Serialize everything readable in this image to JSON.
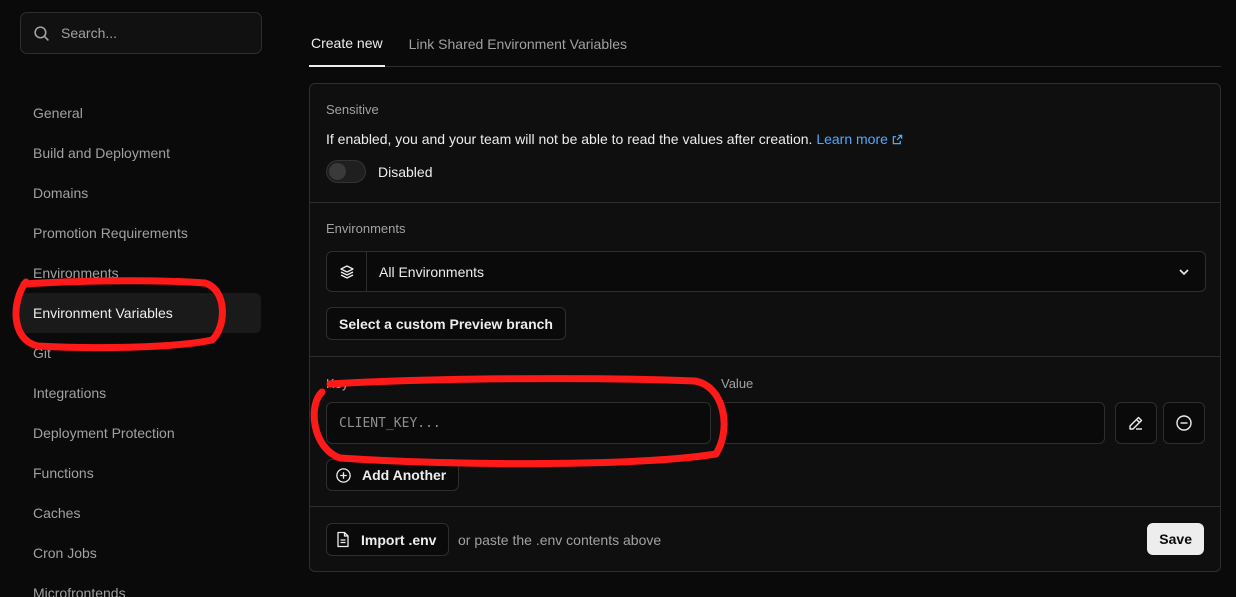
{
  "search": {
    "placeholder": "Search..."
  },
  "sidebar": {
    "items": [
      {
        "label": "General"
      },
      {
        "label": "Build and Deployment"
      },
      {
        "label": "Domains"
      },
      {
        "label": "Promotion Requirements"
      },
      {
        "label": "Environments"
      },
      {
        "label": "Environment Variables",
        "active": true
      },
      {
        "label": "Git"
      },
      {
        "label": "Integrations"
      },
      {
        "label": "Deployment Protection"
      },
      {
        "label": "Functions"
      },
      {
        "label": "Caches"
      },
      {
        "label": "Cron Jobs"
      },
      {
        "label": "Microfrontends"
      }
    ]
  },
  "tabs": [
    {
      "label": "Create new",
      "active": true
    },
    {
      "label": "Link Shared Environment Variables"
    }
  ],
  "sensitive": {
    "label": "Sensitive",
    "description": "If enabled, you and your team will not be able to read the values after creation.",
    "learn_more": "Learn more",
    "toggle_state": "Disabled"
  },
  "environments": {
    "label": "Environments",
    "selected": "All Environments",
    "preview_branch_button": "Select a custom Preview branch"
  },
  "variables": {
    "key_label": "Key",
    "value_label": "Value",
    "key_placeholder": "CLIENT_KEY...",
    "value_placeholder": "",
    "add_another": "Add Another"
  },
  "footer": {
    "import_button": "Import .env",
    "paste_hint": "or paste the .env contents above",
    "save_button": "Save"
  },
  "colors": {
    "background": "#0a0a0a",
    "link": "#52a8ff",
    "annotation": "#ff1a1a"
  }
}
